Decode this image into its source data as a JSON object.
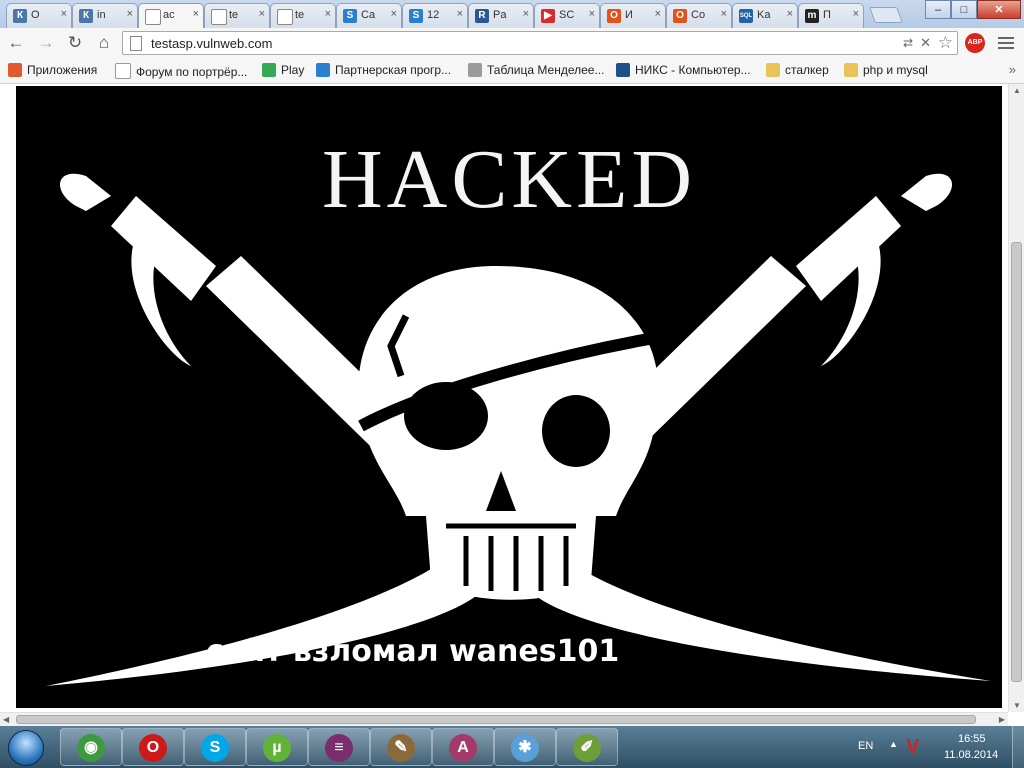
{
  "tabs": [
    {
      "title": "О",
      "icon": "vk-icon",
      "color": "#4a76a8",
      "glyph": "К"
    },
    {
      "title": "in",
      "icon": "vk-icon",
      "color": "#4a76a8",
      "glyph": "К"
    },
    {
      "title": "ac",
      "icon": "page-icon",
      "color": "#ffffff",
      "glyph": ""
    },
    {
      "title": "te",
      "icon": "page-icon",
      "color": "#ffffff",
      "glyph": ""
    },
    {
      "title": "te",
      "icon": "page-icon",
      "color": "#ffffff",
      "glyph": ""
    },
    {
      "title": "Ca",
      "icon": "s-icon",
      "color": "#2a7fcf",
      "glyph": "S"
    },
    {
      "title": "12",
      "icon": "s-icon",
      "color": "#2a7fcf",
      "glyph": "S"
    },
    {
      "title": "Pa",
      "icon": "r-icon",
      "color": "#2b5797",
      "glyph": "R"
    },
    {
      "title": "SC",
      "icon": "youtube-icon",
      "color": "#d92b2b",
      "glyph": "▶"
    },
    {
      "title": "И",
      "icon": "office-icon",
      "color": "#e0531a",
      "glyph": "O"
    },
    {
      "title": "Co",
      "icon": "office-icon",
      "color": "#e0531a",
      "glyph": "O"
    },
    {
      "title": "Ka",
      "icon": "sql-icon",
      "color": "#2463a8",
      "glyph": "SQL"
    },
    {
      "title": "П",
      "icon": "m-icon",
      "color": "#222222",
      "glyph": "m"
    }
  ],
  "active_tab_index": 2,
  "window": {
    "minimize": "–",
    "maximize": "□",
    "close": "✕"
  },
  "toolbar": {
    "back": "←",
    "forward": "→",
    "reload": "↻",
    "home": "⌂",
    "url": "testasp.vulnweb.com",
    "abp_label": "ABP"
  },
  "bookmarks": [
    {
      "label": "Приложения",
      "icon": "apps-icon",
      "color": "#e05a2b"
    },
    {
      "label": "Форум по портрёр...",
      "icon": "page-icon",
      "color": "#ffffff"
    },
    {
      "label": "Play",
      "icon": "play-icon",
      "color": "#34a853"
    },
    {
      "label": "Партнерская прогр...",
      "icon": "s-icon",
      "color": "#2a7fcf"
    },
    {
      "label": "Таблица Менделее...",
      "icon": "table-icon",
      "color": "#9a9a9a"
    },
    {
      "label": "НИКС - Компьютер...",
      "icon": "nix-icon",
      "color": "#1c4f8c"
    },
    {
      "label": "сталкер",
      "icon": "folder-icon",
      "color": "#e8c35a"
    },
    {
      "label": "php и mysql",
      "icon": "folder-icon",
      "color": "#e8c35a"
    }
  ],
  "page": {
    "title": "HACKED",
    "caption": "сайт взломал wanes101"
  },
  "taskbar": {
    "apps": [
      {
        "name": "chrome",
        "icon": "chrome-icon",
        "color": "#3d9a3d",
        "glyph": "◉"
      },
      {
        "name": "opera",
        "icon": "opera-icon",
        "color": "#cc1a1a",
        "glyph": "O"
      },
      {
        "name": "skype",
        "icon": "skype-icon",
        "color": "#00a8e8",
        "glyph": "S"
      },
      {
        "name": "utorrent",
        "icon": "utorrent-icon",
        "color": "#61b239",
        "glyph": "µ"
      },
      {
        "name": "winrar",
        "icon": "winrar-icon",
        "color": "#7a2d6d",
        "glyph": "≡"
      },
      {
        "name": "carrot",
        "icon": "carrot-icon",
        "color": "#8b6a3a",
        "glyph": "✎"
      },
      {
        "name": "access",
        "icon": "access-icon",
        "color": "#a33a6a",
        "glyph": "A"
      },
      {
        "name": "paint",
        "icon": "paint-icon",
        "color": "#5aa0d8",
        "glyph": "✱"
      },
      {
        "name": "notepad",
        "icon": "notepad-icon",
        "color": "#6e9e3a",
        "glyph": "✐"
      }
    ],
    "lang": "EN",
    "time": "16:55",
    "date": "11.08.2014"
  }
}
